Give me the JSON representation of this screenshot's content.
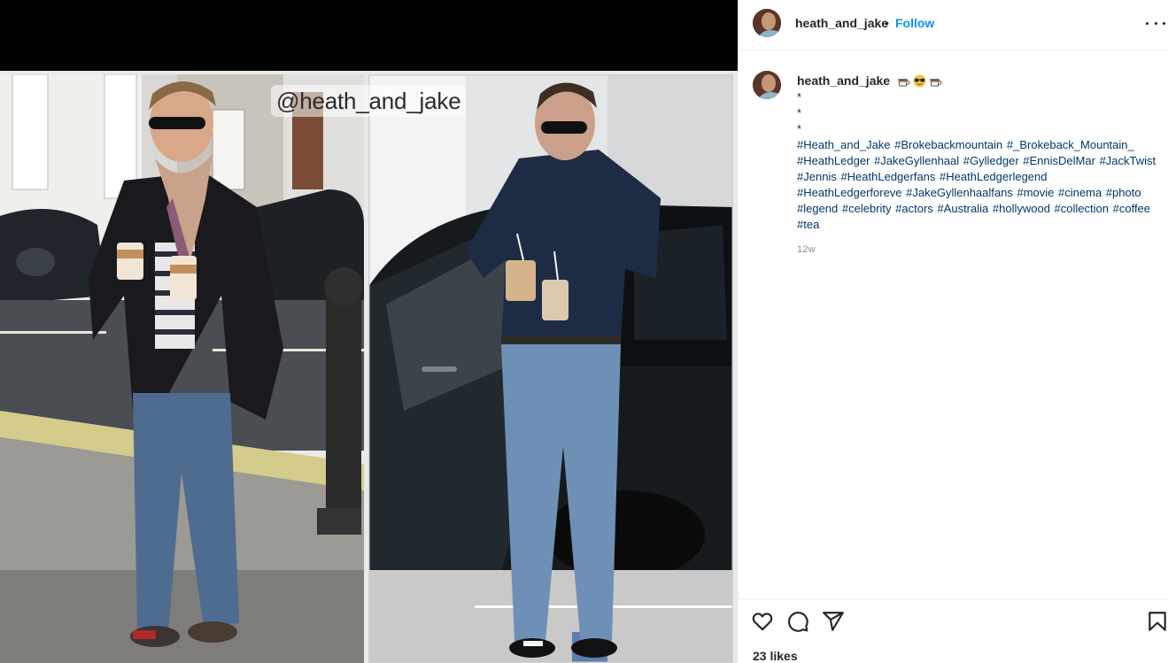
{
  "media": {
    "watermark": "@heath_and_jake"
  },
  "header": {
    "username": "heath_and_jake",
    "separator": "•",
    "follow_label": "Follow"
  },
  "caption": {
    "username": "heath_and_jake",
    "emojis": [
      "hot-beverage-icon",
      "sunglasses-face-icon",
      "hot-beverage-icon"
    ],
    "star_lines": [
      "*",
      "*",
      "*"
    ],
    "hashtags": [
      "#Heath_and_Jake",
      "#Brokebackmountain",
      "#_Brokeback_Mountain_",
      "#HeathLedger",
      "#JakeGyllenhaal",
      "#Gylledger",
      "#EnnisDelMar",
      "#JackTwist",
      "#Jennis",
      "#HeathLedgerfans",
      "#HeathLedgerlegend",
      "#HeathLedgerforeve",
      "#JakeGyllenhaalfans",
      "#movie",
      "#cinema",
      "#photo",
      "#legend",
      "#celebrity",
      "#actors",
      "#Australia",
      "#hollywood",
      "#collection",
      "#coffee",
      "#tea"
    ],
    "timestamp": "12w"
  },
  "actions": {
    "icons": [
      "heart-icon",
      "comment-icon",
      "share-icon",
      "bookmark-icon"
    ],
    "likes": "23 likes"
  },
  "colors": {
    "link": "#00376b",
    "follow": "#0095f6",
    "text": "#262626",
    "muted": "#8e8e8e",
    "divider": "#efefef"
  }
}
